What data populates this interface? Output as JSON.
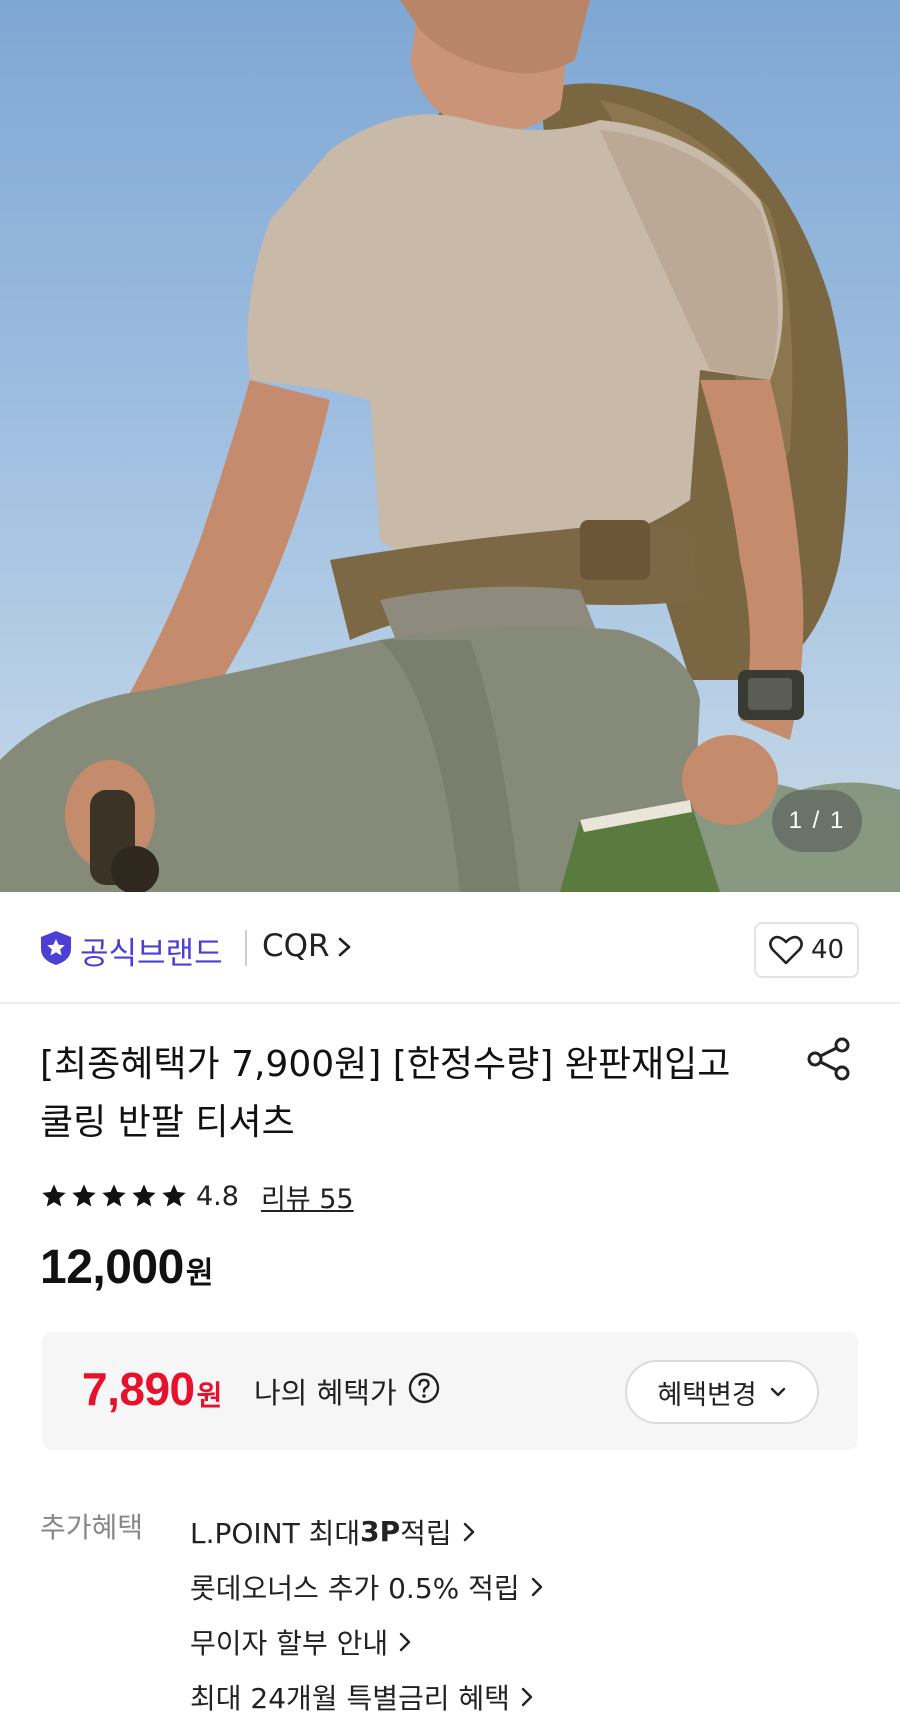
{
  "hero": {
    "pager": "1 / 1"
  },
  "brand": {
    "badge_label": "공식브랜드",
    "name": "CQR",
    "badge_icon": "star-shield-icon",
    "like_count": "40",
    "accent_color": "#4b3fd6"
  },
  "product": {
    "title": "[최종혜택가 7,900원] [한정수량] 완판재입고 쿨링 반팔 티셔츠",
    "rating": {
      "stars": 5,
      "score": "4.8",
      "review_link": "리뷰 55"
    },
    "price": {
      "amount": "12,000",
      "unit": "원"
    }
  },
  "benefit": {
    "price": "7,890",
    "unit": "원",
    "label": "나의 혜택가",
    "change_button": "혜택변경",
    "price_color": "#e8112d"
  },
  "extra_benefits": {
    "label": "추가혜택",
    "items": [
      {
        "prefix": "L.POINT 최대 ",
        "bold": "3P",
        "suffix": " 적립"
      },
      {
        "prefix": "롯데오너스 추가 0.5% 적립",
        "bold": "",
        "suffix": ""
      },
      {
        "prefix": "무이자 할부 안내",
        "bold": "",
        "suffix": ""
      },
      {
        "prefix": "최대 24개월 특별금리 혜택",
        "bold": "",
        "suffix": ""
      }
    ]
  }
}
